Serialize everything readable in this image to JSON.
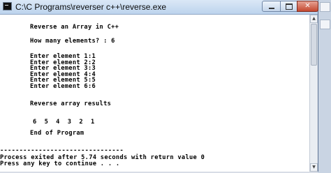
{
  "window": {
    "title": "C:\\C Programs\\reverser c++\\reverse.exe",
    "icon": "console-icon",
    "controls": {
      "minimize": "minimize-icon",
      "maximize": "maximize-icon",
      "close": "close-icon"
    },
    "close_glyph": "✕"
  },
  "console": {
    "lines": [
      "Reverse an Array in C++",
      "How many elements? : 6",
      "Enter element 1:1",
      "Enter element 2:2",
      "Enter element 3:3",
      "Enter element 4:4",
      "Enter element 5:5",
      "Enter element 6:6",
      "Reverse array results",
      "6  5  4  3  2  1",
      "End of Program",
      "--------------------------------",
      "Process exited after 5.74 seconds with return value 0",
      "Press any key to continue . . ."
    ]
  },
  "scrollbar": {
    "up_glyph": "▲",
    "down_glyph": "▼"
  }
}
